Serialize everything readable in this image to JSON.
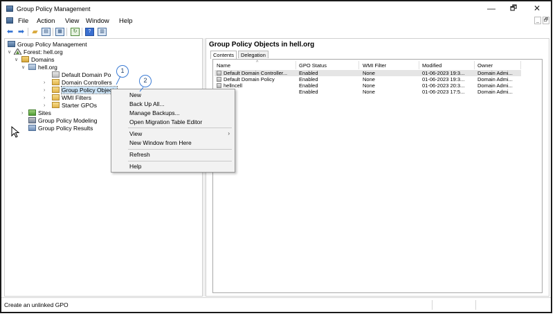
{
  "window": {
    "title": "Group Policy Management",
    "controls": {
      "minimize": "—",
      "maximize": "🗗",
      "close": "✕"
    }
  },
  "menubar": {
    "items": [
      "File",
      "Action",
      "View",
      "Window",
      "Help"
    ],
    "mdi_controls": {
      "minimize": "_",
      "restore": "🗗"
    }
  },
  "toolbar": {
    "back_icon": "back-arrow-icon",
    "forward_icon": "forward-arrow-icon",
    "buttons": [
      "up-folder-icon",
      "show-hide-tree-icon",
      "properties-icon",
      "refresh-icon",
      "help-icon",
      "console-icon"
    ]
  },
  "tree": {
    "root": "Group Policy Management",
    "forest": "Forest: hell.org",
    "domains": "Domains",
    "domain": "hell.org",
    "default_domain_policy": "Default Domain Po",
    "domain_controllers": "Domain Controllers",
    "gpo_container": "Group Policy Objects",
    "wmi_filters": "WMI Filters",
    "starter_gpos": "Starter GPOs",
    "sites": "Sites",
    "modeling": "Group Policy Modeling",
    "results": "Group Policy Results"
  },
  "context_menu": {
    "items": [
      "New",
      "Back Up All...",
      "Manage Backups...",
      "Open Migration Table Editor",
      "View",
      "New Window from Here",
      "Refresh",
      "Help"
    ]
  },
  "callouts": [
    "1",
    "2"
  ],
  "right_pane": {
    "title": "Group Policy Objects in hell.org",
    "tabs": [
      "Contents",
      "Delegation"
    ],
    "sort_indicator": "^",
    "columns": [
      "Name",
      "GPO Status",
      "WMI Filter",
      "Modified",
      "Owner"
    ],
    "rows": [
      [
        "Default Domain Controller...",
        "Enabled",
        "None",
        "01-06-2023 19:3...",
        "Domain Admi..."
      ],
      [
        "Default Domain Policy",
        "Enabled",
        "None",
        "01-06-2023 19:3...",
        "Domain Admi..."
      ],
      [
        "hellncell",
        "Enabled",
        "None",
        "01-06-2023 20:3...",
        "Domain Admi..."
      ],
      [
        "",
        "Enabled",
        "None",
        "01-06-2023 17:5...",
        "Domain Admi..."
      ]
    ]
  },
  "statusbar": {
    "text": "Create an unlinked GPO"
  }
}
